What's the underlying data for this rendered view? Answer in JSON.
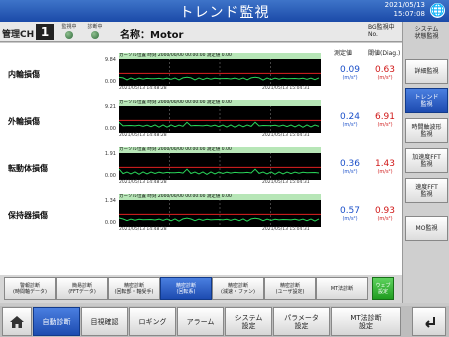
{
  "title": "トレンド監視",
  "clock": {
    "date": "2021/05/13",
    "time": "15:07:08"
  },
  "header": {
    "ch_label": "管理CH",
    "ch_value": "1",
    "lamp1": "監視中",
    "lamp2": "診断中",
    "name": "名称：Motor",
    "bg_label": "BG監視中\nNo."
  },
  "columns": {
    "measured": "測定値",
    "threshold": "閾値(Diag.)"
  },
  "rows": [
    {
      "label": "内輪損傷",
      "ymax": "9.84",
      "ymin": "0.00",
      "info": "カーソル位置 時刻 2000/00/00 00:00:00 測定値 0.00",
      "ts_start": "2021/05/13 14:48:28",
      "ts_end": "2021/05/13 15:04:31",
      "measured": "0.09",
      "threshold": "0.63",
      "unit": "(m/s²)"
    },
    {
      "label": "外輪損傷",
      "ymax": "9.21",
      "ymin": "0.00",
      "info": "カーソル位置 時刻 2000/00/00 00:00:00 測定値 0.00",
      "ts_start": "2021/05/13 14:48:28",
      "ts_end": "2021/05/13 15:04:31",
      "measured": "0.24",
      "threshold": "6.91",
      "unit": "(m/s²)"
    },
    {
      "label": "転動体損傷",
      "ymax": "1.91",
      "ymin": "0.00",
      "info": "カーソル位置 時刻 2000/00/00 00:00:00 測定値 0.00",
      "ts_start": "2021/05/13 14:48:28",
      "ts_end": "2021/05/13 15:04:31",
      "measured": "0.36",
      "threshold": "1.43",
      "unit": "(m/s²)"
    },
    {
      "label": "保持器損傷",
      "ymax": "1.34",
      "ymin": "0.00",
      "info": "カーソル位置 時刻 2000/00/00 00:00:00 測定値 0.00",
      "ts_start": "2021/05/13 14:48:28",
      "ts_end": "2021/05/13 15:04:31",
      "measured": "0.57",
      "threshold": "0.93",
      "unit": "(m/s²)"
    }
  ],
  "menu": {
    "system_status": "システム\n状態監視",
    "detail": "詳細監視",
    "trend": "トレンド\n監視",
    "time_waveform": "時間軸波形\n監視",
    "accel_fft": "加速度FFT\n監視",
    "velocity_fft": "速度FFT\n監視",
    "mo": "MO監視"
  },
  "diag_buttons": [
    {
      "label": "警報診断\n(時間軸データ)",
      "active": false
    },
    {
      "label": "簡易診断\n(FFTデータ)",
      "active": false
    },
    {
      "label": "精密診断\n(回転部・軸受手)",
      "active": false
    },
    {
      "label": "精密診断\n(回転系)",
      "active": true
    },
    {
      "label": "精密診断\n(減速・ファン)",
      "active": false
    },
    {
      "label": "精密診断\n(ユーザ設定)",
      "active": false
    },
    {
      "label": "MT法診断",
      "active": false
    }
  ],
  "green_button": "ウェブ\n設定",
  "nav": {
    "home_icon": "home-icon",
    "items": [
      "自動診断",
      "目視確認",
      "ロギング",
      "アラーム",
      "システム\n設定",
      "パラメータ\n設定",
      "MT法診断\n設定"
    ],
    "back_icon": "return-icon"
  },
  "colors": {
    "accent": "#1d4bb0",
    "measured": "#1a4fc9",
    "threshold": "#d01818",
    "trace_green": "#29d65a",
    "trace_red": "#e02020"
  }
}
